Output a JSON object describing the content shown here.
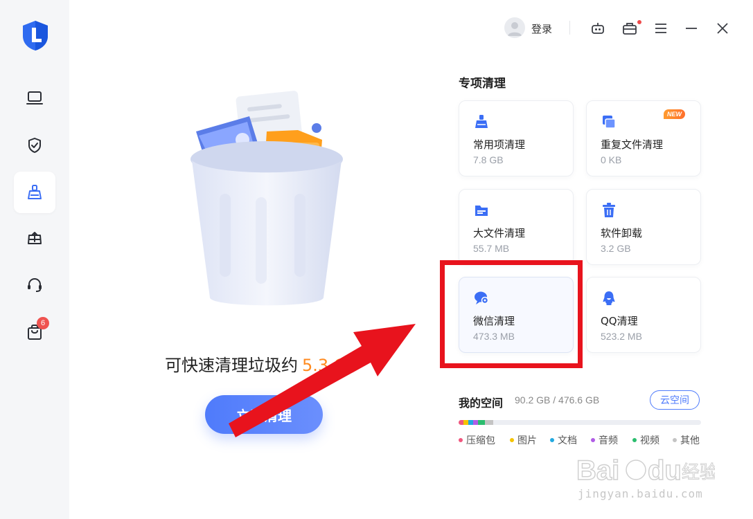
{
  "titlebar": {
    "login_label": "登录",
    "icons": [
      "user-avatar",
      "robot-icon",
      "toolbox-icon",
      "menu-icon",
      "minimize-icon",
      "close-icon"
    ]
  },
  "sidebar": {
    "items": [
      {
        "name": "computer-icon",
        "active": false
      },
      {
        "name": "shield-check-icon",
        "active": false
      },
      {
        "name": "broom-icon",
        "active": true
      },
      {
        "name": "drive-icon",
        "active": false
      },
      {
        "name": "headset-icon",
        "active": false
      },
      {
        "name": "shopping-bag-icon",
        "active": false,
        "badge": "6"
      }
    ]
  },
  "hero": {
    "text": "可快速清理垃圾约",
    "amount": "5.3 G",
    "button_label": "立即清理"
  },
  "special_cleaning": {
    "title": "专项清理",
    "cards": [
      {
        "name": "常用项清理",
        "size": "7.8 GB",
        "icon": "broom-icon"
      },
      {
        "name": "重复文件清理",
        "size": "0 KB",
        "icon": "duplicate-files-icon",
        "tag": "NEW"
      },
      {
        "name": "大文件清理",
        "size": "55.7 MB",
        "icon": "folder-icon"
      },
      {
        "name": "软件卸载",
        "size": "3.2 GB",
        "icon": "trash-icon"
      },
      {
        "name": "微信清理",
        "size": "473.3 MB",
        "icon": "wechat-icon"
      },
      {
        "name": "QQ清理",
        "size": "523.2 MB",
        "icon": "qq-icon"
      }
    ]
  },
  "storage": {
    "title": "我的空间",
    "usage": "90.2 GB / 476.6 GB",
    "cloud_button": "云空间",
    "used_fraction": 0.19,
    "legend": [
      {
        "label": "压缩包",
        "color": "#f0577f"
      },
      {
        "label": "图片",
        "color": "#f5c400"
      },
      {
        "label": "文档",
        "color": "#22a9e0"
      },
      {
        "label": "音频",
        "color": "#b05ce6"
      },
      {
        "label": "视频",
        "color": "#2bbd6e"
      },
      {
        "label": "其他",
        "color": "#c4c4c4"
      }
    ]
  },
  "watermark": {
    "text": "jingyan.baidu.com"
  },
  "colors": {
    "accent": "#4f7bfb",
    "amount": "#ff8a1f",
    "highlight": "#e8131d"
  }
}
